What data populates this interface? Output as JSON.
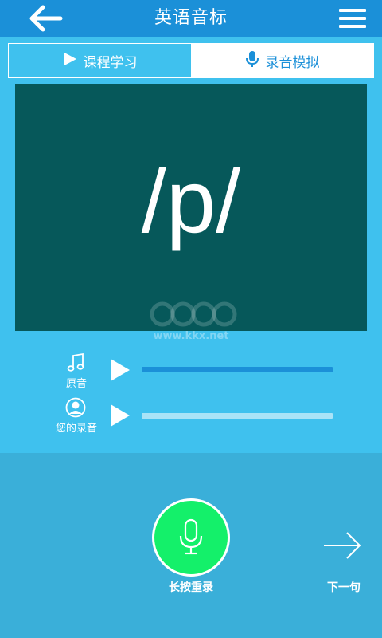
{
  "header": {
    "title": "英语音标",
    "back_icon": "arrow-left-icon",
    "menu_icon": "hamburger-menu-icon"
  },
  "tabs": [
    {
      "label": "课程学习",
      "icon": "play-icon",
      "active": false
    },
    {
      "label": "录音模拟",
      "icon": "microphone-icon",
      "active": true
    }
  ],
  "board": {
    "phoneme": "/p/"
  },
  "watermark": {
    "text": "www.kkx.net"
  },
  "audio": {
    "original_label": "原音",
    "original_icon": "music-note-icon",
    "original_progress": 1.0,
    "recording_label": "您的录音",
    "recording_icon": "user-avatar-icon",
    "recording_progress": 0.0
  },
  "actions": {
    "record_label": "长按重录",
    "next_label": "下一句"
  },
  "colors": {
    "topbar": "#1b90d8",
    "background": "#3fc1ee",
    "board": "#06585a",
    "bottom_panel": "#3aafd9",
    "record_button": "#14f06a",
    "original_bar": "#1b90d8",
    "recording_bar": "#a9e3f7"
  }
}
